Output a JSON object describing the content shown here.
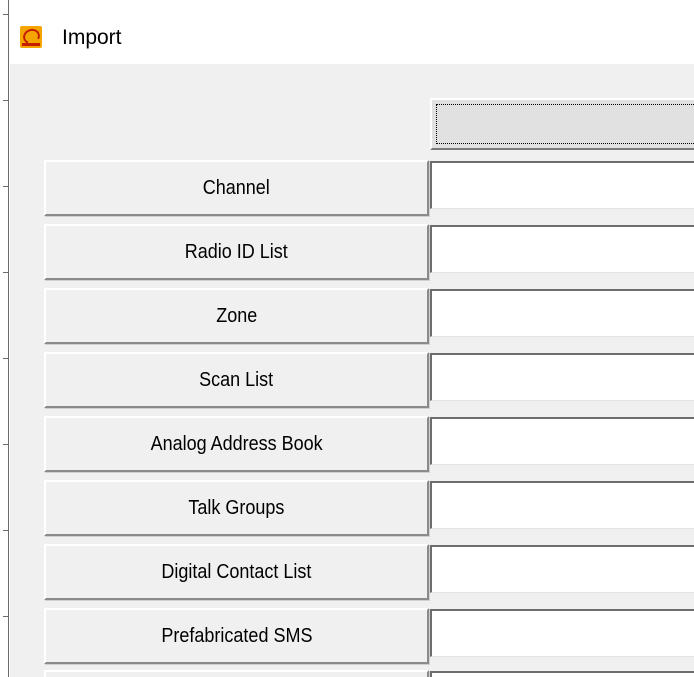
{
  "window": {
    "title": "Import"
  },
  "icons": {
    "app": "app-logo-icon"
  },
  "rows": [
    {
      "label": "Channel"
    },
    {
      "label": "Radio ID List"
    },
    {
      "label": "Zone"
    },
    {
      "label": "Scan List"
    },
    {
      "label": "Analog Address Book"
    },
    {
      "label": "Talk Groups"
    },
    {
      "label": "Digital Contact List"
    },
    {
      "label": "Prefabricated SMS"
    }
  ],
  "colors": {
    "highlight": "#f6f12d",
    "icon_bg": "#f5a500",
    "icon_fg": "#c51d00"
  }
}
